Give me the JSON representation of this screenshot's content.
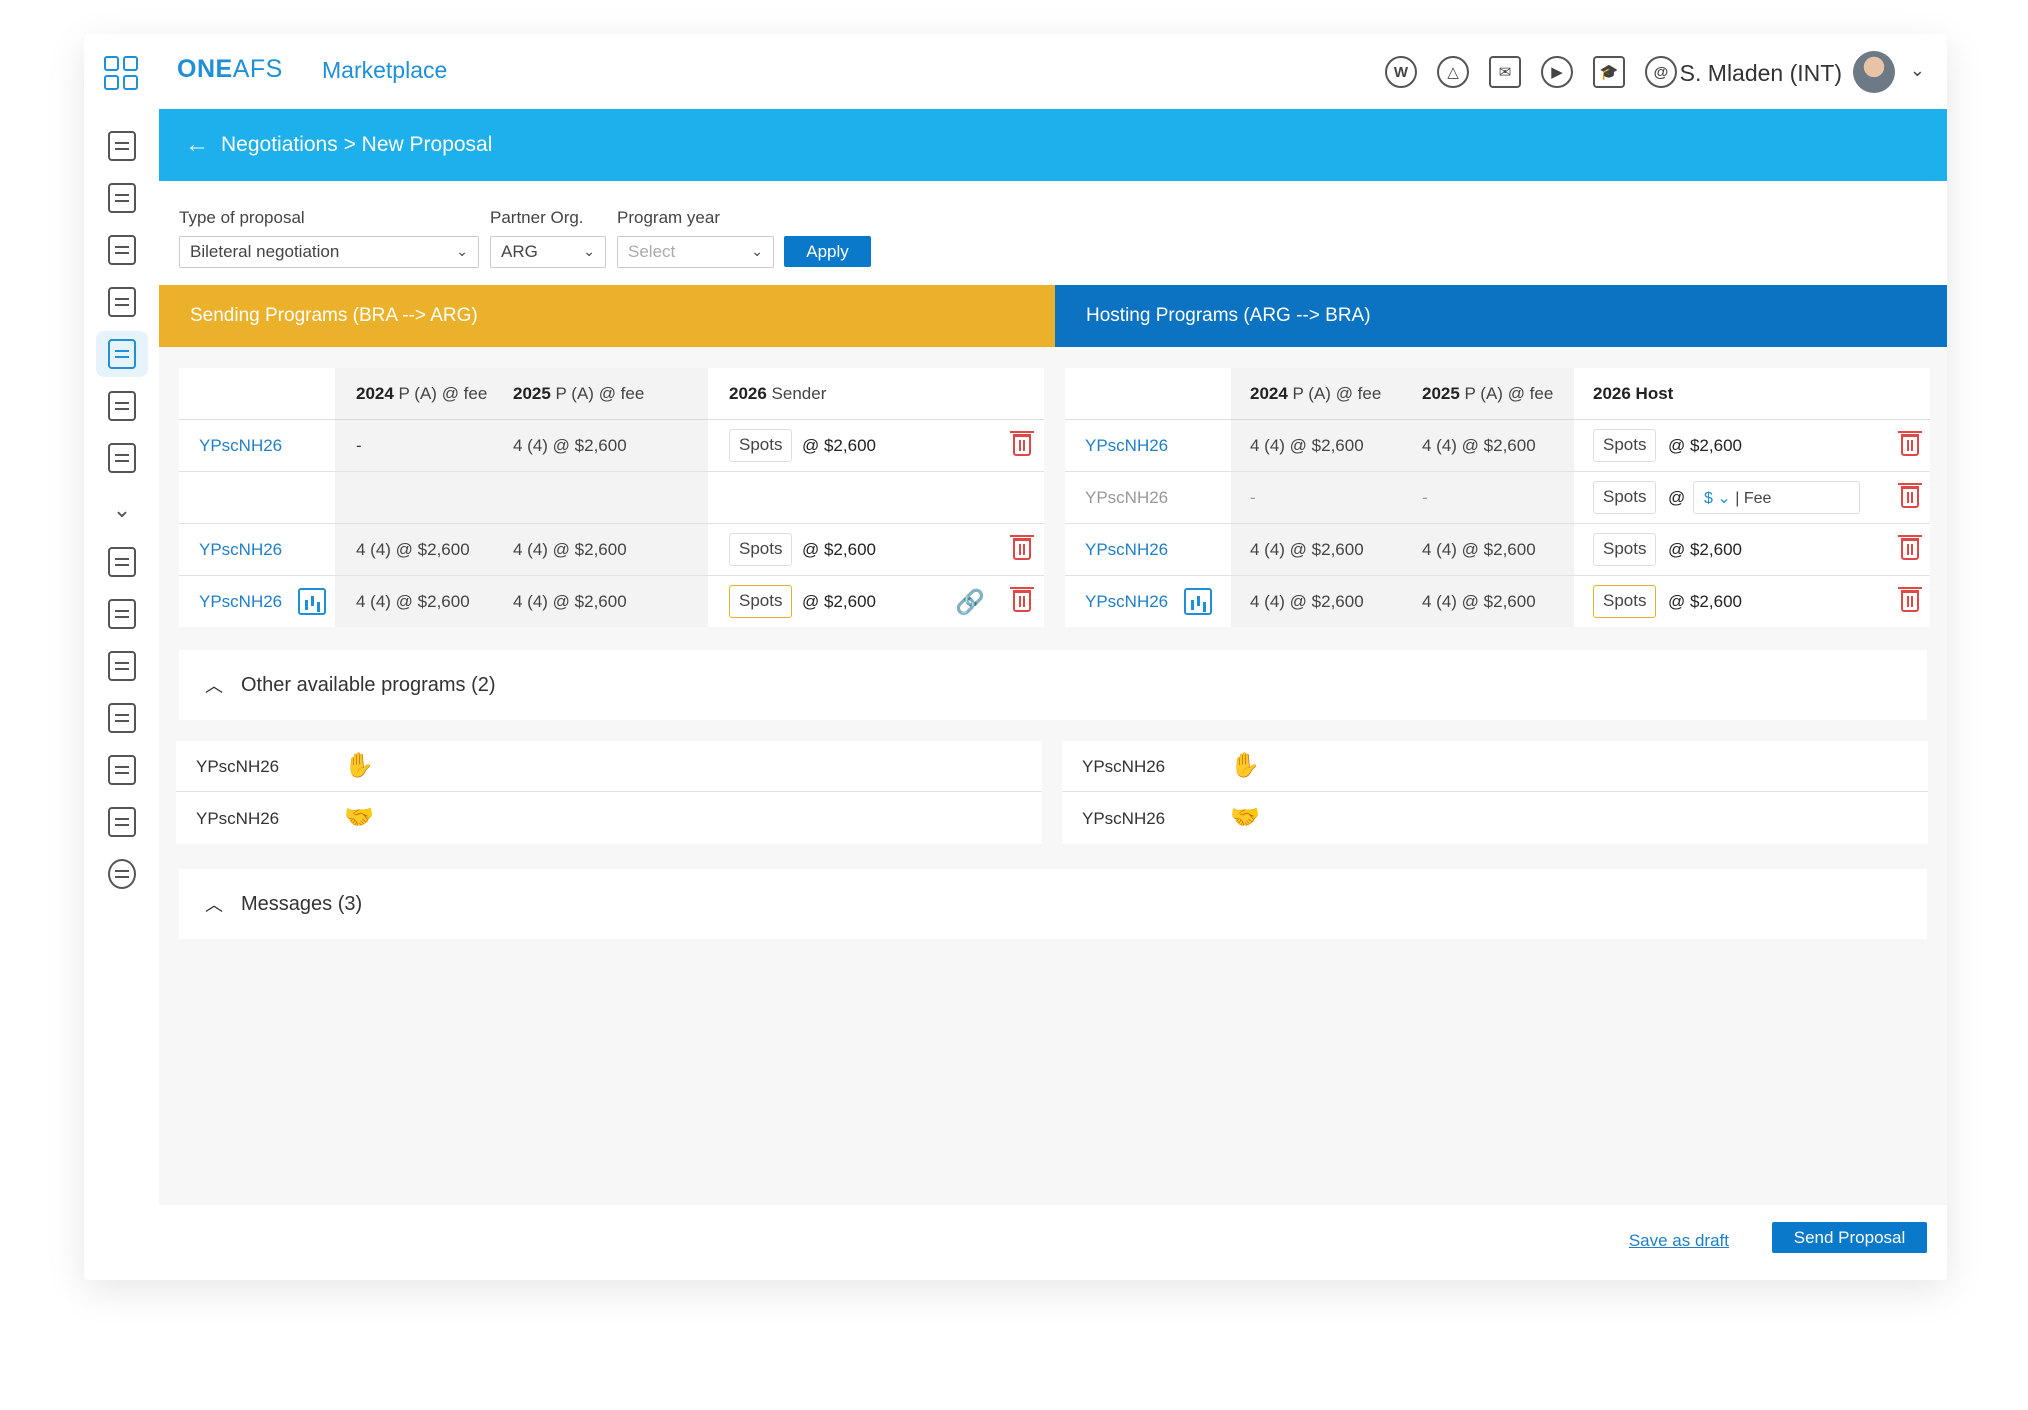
{
  "app": {
    "brand_bold": "ONE",
    "brand_light": "AFS",
    "section": "Marketplace",
    "user_name": "S. Mladen (INT)",
    "top_icons": [
      "wikipedia-icon",
      "drive-icon",
      "mail-icon",
      "video-call-icon",
      "graduation-cap-icon",
      "workplace-icon"
    ]
  },
  "header": {
    "breadcrumb": "Negotiations > New Proposal"
  },
  "filters": {
    "type_label": "Type of proposal",
    "type_value": "Bileteral negotiation",
    "partner_label": "Partner Org.",
    "partner_value": "ARG",
    "year_label": "Program year",
    "year_placeholder": "Select",
    "apply_label": "Apply"
  },
  "sending": {
    "title": "Sending Programs (BRA --> ARG)",
    "headers": {
      "c1_bold": "2024",
      "c1_rest": " P (A) @ fee",
      "c2_bold": "2025",
      "c2_rest": " P (A) @ fee",
      "c3_bold": "2026",
      "c3_rest": " Sender"
    },
    "rows": [
      {
        "code": "YPscNH26",
        "y2024": "-",
        "y2025": "4 (4)  @ $2,600",
        "spots": "Spots",
        "price": "@ $2,600"
      },
      {
        "code": "",
        "y2024": "",
        "y2025": "",
        "spots": "",
        "price": ""
      },
      {
        "code": "YPscNH26",
        "y2024": "4 (4)  @ $2,600",
        "y2025": "4 (4)  @ $2,600",
        "spots": "Spots",
        "price": "@ $2,600"
      },
      {
        "code": "YPscNH26",
        "y2024": "4 (4)  @ $2,600",
        "y2025": "4 (4)  @ $2,600",
        "spots": "Spots",
        "price": "@ $2,600"
      }
    ]
  },
  "hosting": {
    "title": "Hosting Programs (ARG --> BRA)",
    "headers": {
      "c1_bold": "2024",
      "c1_rest": " P (A) @ fee",
      "c2_bold": "2025",
      "c2_rest": " P (A) @ fee",
      "c3_bold": "2026 Host"
    },
    "rows": [
      {
        "code": "YPscNH26",
        "y2024": "4 (4)  @ $2,600",
        "y2025": "4 (4)  @ $2,600",
        "spots": "Spots",
        "price": "@ $2,600"
      },
      {
        "code": "YPscNH26",
        "y2024": "-",
        "y2025": "-",
        "spots": "Spots",
        "at": "@",
        "currency": "$",
        "fee_placeholder": "| Fee"
      },
      {
        "code": "YPscNH26",
        "y2024": "4 (4)  @ $2,600",
        "y2025": "4 (4)  @ $2,600",
        "spots": "Spots",
        "price": "@ $2,600"
      },
      {
        "code": "YPscNH26",
        "y2024": "4 (4)  @ $2,600",
        "y2025": "4 (4)  @ $2,600",
        "spots": "Spots",
        "price": "@ $2,600"
      }
    ]
  },
  "other_programs": {
    "title": "Other available programs (2)",
    "left": [
      {
        "code": "YPscNH26",
        "action": "hand-icon"
      },
      {
        "code": "YPscNH26",
        "action": "handshake-icon"
      }
    ],
    "right": [
      {
        "code": "YPscNH26",
        "action": "hand-icon"
      },
      {
        "code": "YPscNH26",
        "action": "handshake-icon"
      }
    ]
  },
  "messages": {
    "title": "Messages (3)"
  },
  "footer": {
    "save_draft": "Save as draft",
    "send": "Send Proposal"
  }
}
